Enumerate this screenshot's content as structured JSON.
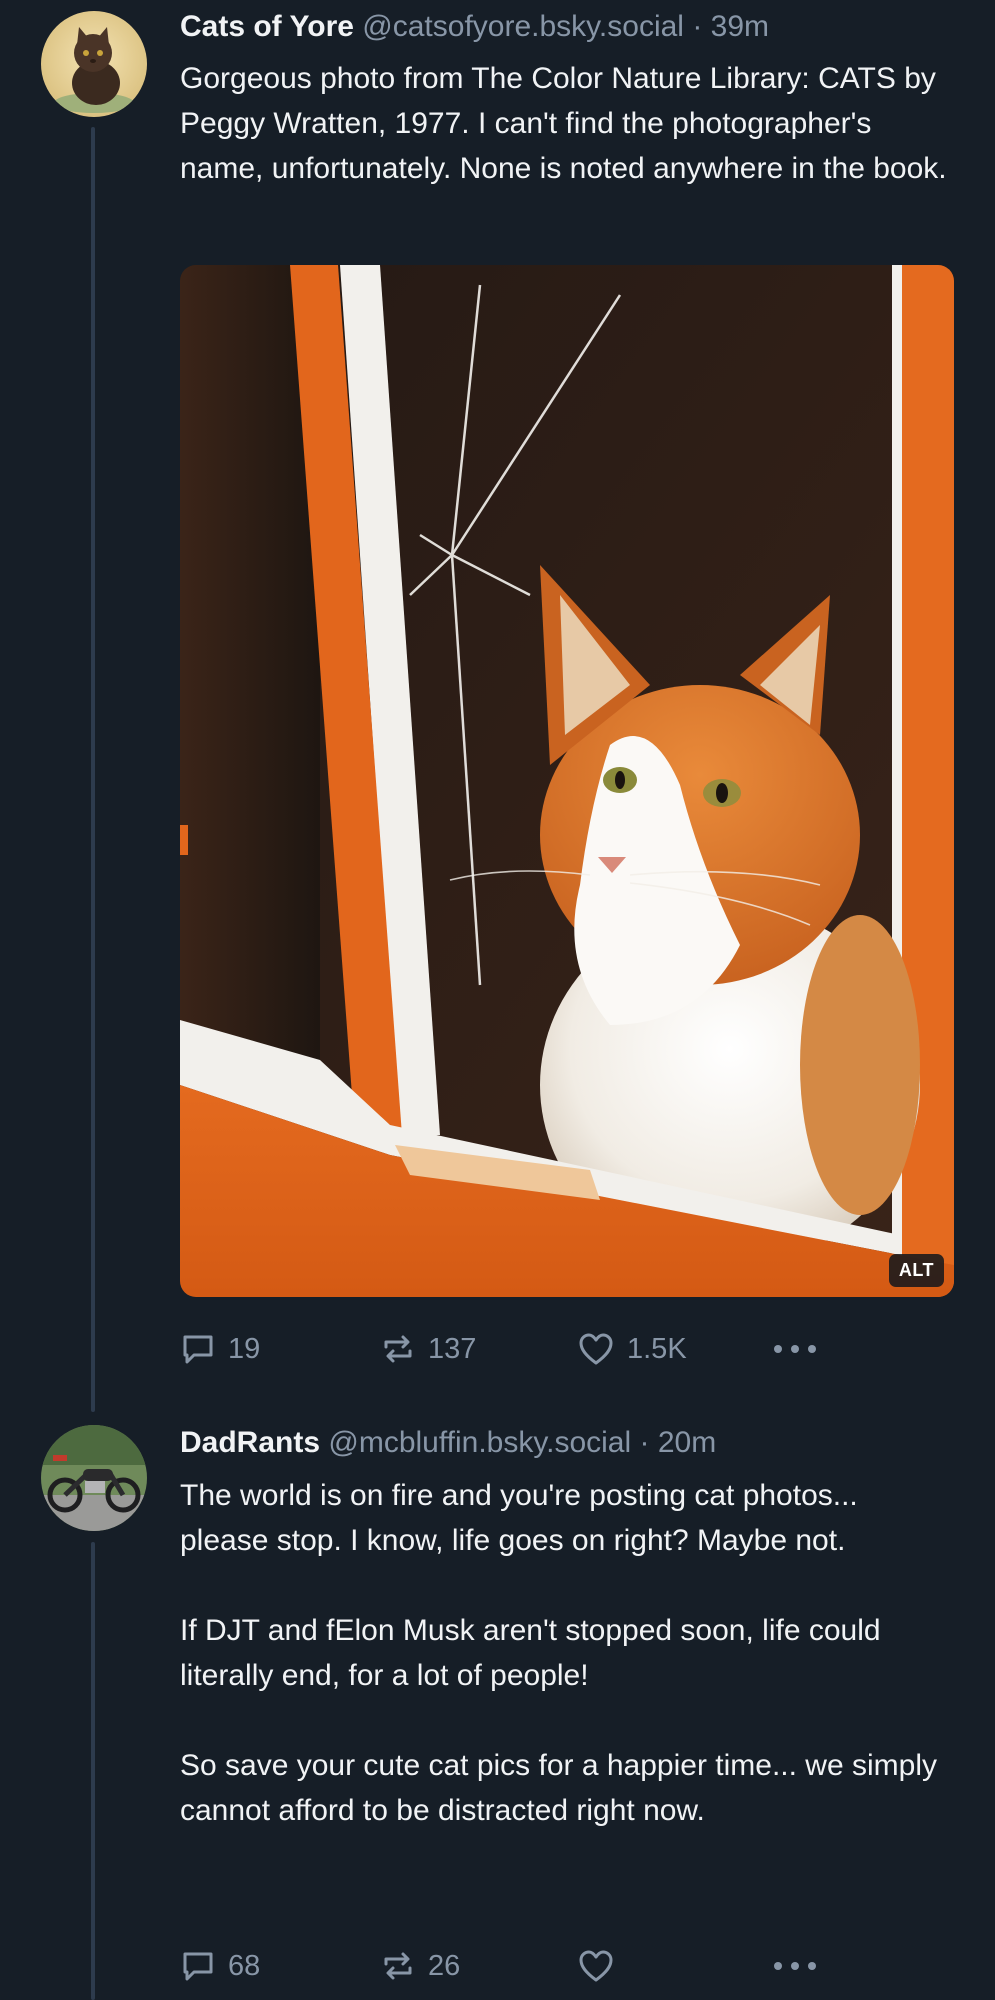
{
  "posts": [
    {
      "display_name": "Cats of Yore",
      "handle": "@catsofyore.bsky.social",
      "separator": "·",
      "time": "39m",
      "text": [
        "Gorgeous photo from The Color Nature Library: CATS by Peggy Wratten, 1977. I can't find the photographer's name, unfortunately. None is noted anywhere in the book."
      ],
      "image_alt_badge": "ALT",
      "replies": "19",
      "reposts": "137",
      "likes": "1.5K"
    },
    {
      "display_name": "DadRants",
      "handle": "@mcbluffin.bsky.social",
      "separator": "·",
      "time": "20m",
      "text": [
        "The world is on fire and you're posting cat photos... please stop. I know, life goes on right? Maybe not.",
        "If DJT and fElon Musk aren't stopped soon, life could literally end, for a lot of people!",
        "So save your cute cat pics for a happier time... we simply cannot afford to be distracted right now."
      ],
      "replies": "68",
      "reposts": "26",
      "likes": ""
    }
  ],
  "icons": {
    "reply": "reply-bubble-icon",
    "repost": "repost-arrows-icon",
    "like": "heart-icon",
    "more": "more-options-icon"
  },
  "colors": {
    "background": "#161e27",
    "thread_line": "#2d3b4d",
    "muted_text": "#8896a7"
  }
}
